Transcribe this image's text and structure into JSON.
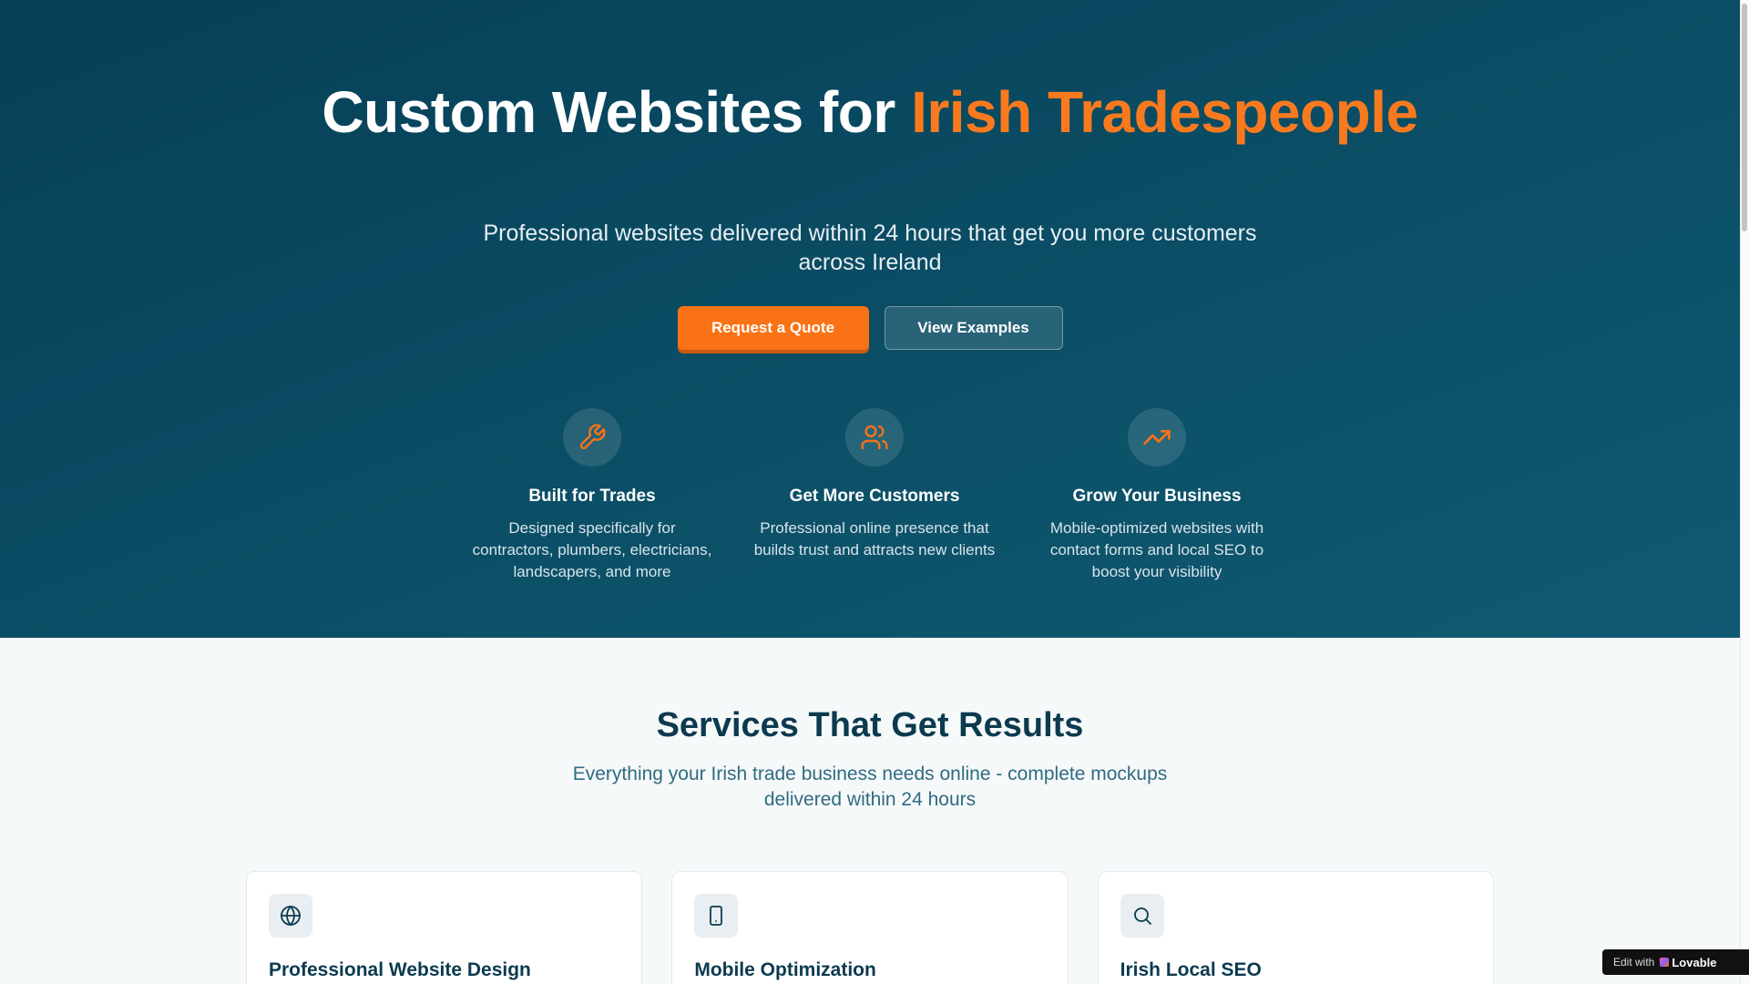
{
  "hero": {
    "title_main": "Custom Websites for ",
    "title_accent": "Irish Tradespeople",
    "subtitle": "Professional websites delivered within 24 hours that get you more customers across Ireland",
    "primary_button": "Request a Quote",
    "secondary_button": "View Examples",
    "features": [
      {
        "icon": "wrench-icon",
        "title": "Built for Trades",
        "text": "Designed specifically for contractors, plumbers, electricians, landscapers, and more"
      },
      {
        "icon": "users-icon",
        "title": "Get More Customers",
        "text": "Professional online presence that builds trust and attracts new clients"
      },
      {
        "icon": "trending-up-icon",
        "title": "Grow Your Business",
        "text": "Mobile-optimized websites with contact forms and local SEO to boost your visibility"
      }
    ]
  },
  "services": {
    "title": "Services That Get Results",
    "subtitle": "Everything your Irish trade business needs online - complete mockups delivered within 24 hours",
    "cards": [
      {
        "icon": "globe-icon",
        "title": "Professional Website Design"
      },
      {
        "icon": "smartphone-icon",
        "title": "Mobile Optimization"
      },
      {
        "icon": "search-icon",
        "title": "Irish Local SEO"
      }
    ]
  },
  "badge": {
    "prefix": "Edit with",
    "brand": "Lovable",
    "close": "×"
  },
  "colors": {
    "accent": "#f97316",
    "hero_bg": "#0a4c63",
    "heading_dark": "#0c3a4f",
    "subtitle_teal": "#2f6b82"
  }
}
